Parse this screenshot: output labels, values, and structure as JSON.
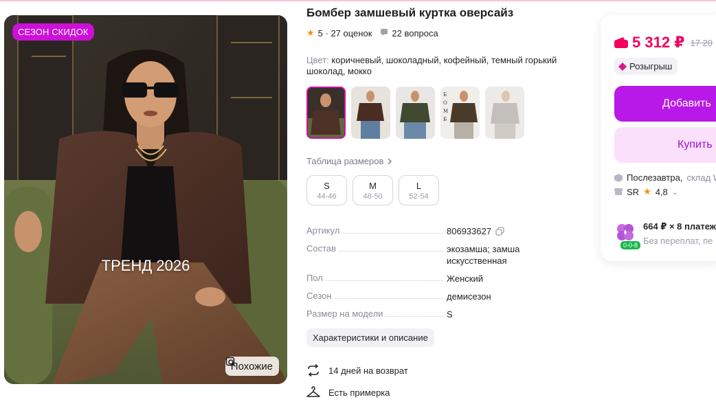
{
  "photo": {
    "promo_badge": "СЕЗОН СКИДОК",
    "overlay_text": "ТРЕНД 2026",
    "similar_button": "Похожие"
  },
  "product": {
    "title": "Бомбер замшевый куртка оверсайз",
    "rating": "5",
    "reviews": "27 оценок",
    "questions": "22 вопроса",
    "color_label": "Цвет:",
    "color_value": "коричневый, шоколадный, кофейный, темный горький шоколад, мокко",
    "size_table_link": "Таблица размеров",
    "sizes": [
      {
        "size": "S",
        "range": "44-46"
      },
      {
        "size": "M",
        "range": "48-50"
      },
      {
        "size": "L",
        "range": "52-54"
      }
    ],
    "specs": [
      {
        "key": "Артикул",
        "value": "806933627"
      },
      {
        "key": "Состав",
        "value": "экозамша; замша искусственная"
      },
      {
        "key": "Пол",
        "value": "Женский"
      },
      {
        "key": "Сезон",
        "value": "демисезон"
      },
      {
        "key": "Размер на модели",
        "value": "S"
      }
    ],
    "characteristics_button": "Характеристики и описание",
    "features": [
      {
        "text": "14 дней на возврат",
        "icon": "return-arrows-icon"
      },
      {
        "text": "Есть примерка",
        "icon": "hanger-icon"
      }
    ]
  },
  "card": {
    "price": "5 312 ₽",
    "old_price": "17 20",
    "raffle": "Розыгрыш",
    "add_button": "Добавить",
    "buy_button": "Купить",
    "delivery": "Послезавтра,",
    "delivery_store": "склад W",
    "seller_name": "SR",
    "seller_rating": "4,8",
    "installment_line1": "664 ₽ × 8 платеж",
    "installment_line2": "Без переплат, пе",
    "installment_badge": "0-0-8"
  },
  "colors": {
    "accent": "#cb11ab",
    "price": "#f2005d",
    "add_button": "#b818e8",
    "buy_button_bg": "#fbe0fb",
    "promo_badge": "#cc10d8"
  }
}
